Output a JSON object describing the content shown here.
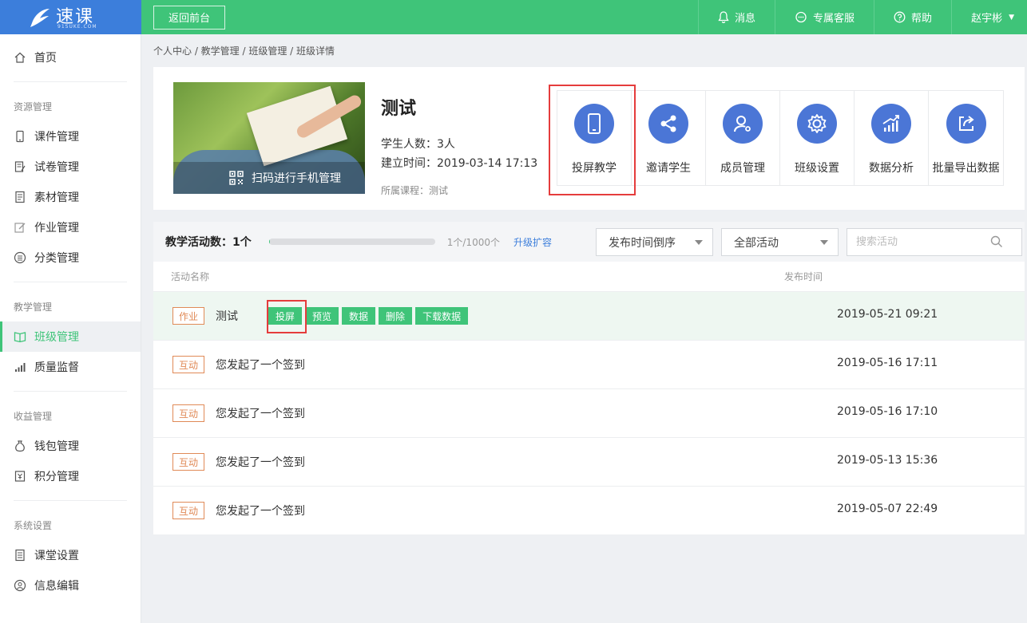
{
  "header": {
    "logo_text": "速课",
    "logo_sub": "91SUKE.COM",
    "back_label": "返回前台",
    "messages_label": "消息",
    "service_label": "专属客服",
    "help_label": "帮助",
    "user_name": "赵宇彬"
  },
  "sidebar": {
    "home": "首页",
    "groups": [
      {
        "title": "资源管理",
        "items": [
          "课件管理",
          "试卷管理",
          "素材管理",
          "作业管理",
          "分类管理"
        ]
      },
      {
        "title": "教学管理",
        "items": [
          "班级管理",
          "质量监督"
        ]
      },
      {
        "title": "收益管理",
        "items": [
          "钱包管理",
          "积分管理"
        ]
      },
      {
        "title": "系统设置",
        "items": [
          "课堂设置",
          "信息编辑"
        ]
      }
    ],
    "active_item": "班级管理"
  },
  "breadcrumb": "个人中心 / 教学管理 / 班级管理 / 班级详情",
  "class_info": {
    "title": "测试",
    "student_count": "学生人数：3人",
    "created": "建立时间：2019-03-14 17:13",
    "course": "所属课程：测试",
    "qr_label": "扫码进行手机管理"
  },
  "tools": [
    {
      "label": "投屏教学",
      "icon": "phone-icon"
    },
    {
      "label": "邀请学生",
      "icon": "share-icon"
    },
    {
      "label": "成员管理",
      "icon": "user-gear-icon"
    },
    {
      "label": "班级设置",
      "icon": "gear-icon"
    },
    {
      "label": "数据分析",
      "icon": "chart-icon"
    },
    {
      "label": "批量导出数据",
      "icon": "export-icon"
    }
  ],
  "activities": {
    "count_label": "教学活动数：1个",
    "progress": 0.001,
    "quota": "1个/1000个",
    "upgrade": "升级扩容",
    "sort_select": "发布时间倒序",
    "filter_select": "全部活动",
    "search_placeholder": "搜索活动",
    "col_name": "活动名称",
    "col_time": "发布时间",
    "actions": [
      "投屏",
      "预览",
      "数据",
      "删除",
      "下载数据"
    ],
    "rows": [
      {
        "tag": "作业",
        "name": "测试",
        "time": "2019-05-21 09:21"
      },
      {
        "tag": "互动",
        "name": "您发起了一个签到",
        "time": "2019-05-16 17:11"
      },
      {
        "tag": "互动",
        "name": "您发起了一个签到",
        "time": "2019-05-16 17:10"
      },
      {
        "tag": "互动",
        "name": "您发起了一个签到",
        "time": "2019-05-13 15:36"
      },
      {
        "tag": "互动",
        "name": "您发起了一个签到",
        "time": "2019-05-07 22:49"
      }
    ]
  },
  "colors": {
    "green": "#3fc479",
    "blue": "#3c7edb",
    "tool_blue": "#4b76d6",
    "tag_orange": "#e08a57",
    "highlight_red": "#e53c3c"
  }
}
